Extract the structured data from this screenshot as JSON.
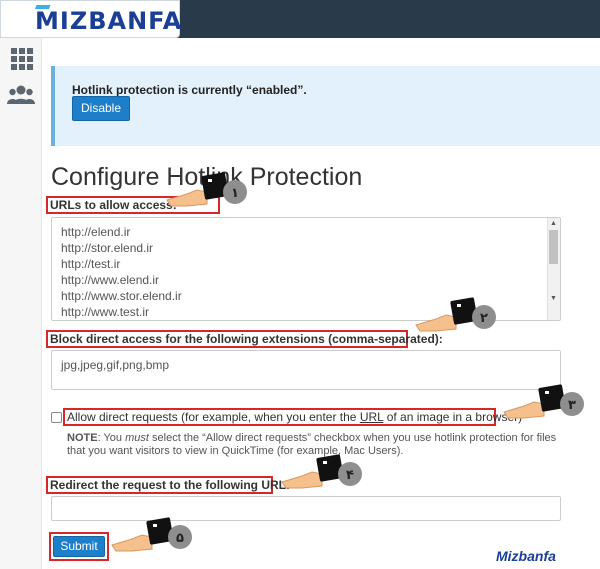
{
  "header": {
    "logo_text": "MIZBANFA"
  },
  "sidebar": {
    "items": [
      {
        "icon": "grid-icon"
      },
      {
        "icon": "users-icon"
      }
    ]
  },
  "alert": {
    "message": "Hotlink protection is currently “enabled”.",
    "button_label": "Disable"
  },
  "page": {
    "title": "Configure Hotlink Protection"
  },
  "urls_section": {
    "label": "URLs to allow access:",
    "urls": [
      "http://elend.ir",
      "http://stor.elend.ir",
      "http://test.ir",
      "http://www.elend.ir",
      "http://www.stor.elend.ir",
      "http://www.test.ir"
    ]
  },
  "extensions_section": {
    "label": "Block direct access for the following extensions (comma-separated):",
    "value": "jpg,jpeg,gif,png,bmp"
  },
  "allow_direct": {
    "label_before": "Allow direct requests (for example, when you enter the ",
    "label_url": "URL",
    "label_after": " of an image in a browser)",
    "checked": false,
    "note_prefix": "NOTE",
    "note_part1": ": You ",
    "note_must": "must",
    "note_part2": " select the “Allow direct requests” checkbox when you use hotlink protection for files that you want visitors to view in QuickTime (for example, Mac Users)."
  },
  "redirect_section": {
    "label": "Redirect the request to the following URL:",
    "value": ""
  },
  "submit": {
    "label": "Submit"
  },
  "step_markers": [
    {
      "number": "۱"
    },
    {
      "number": "۲"
    },
    {
      "number": "۳"
    },
    {
      "number": "۴"
    },
    {
      "number": "۵"
    }
  ],
  "watermark": {
    "text": "Mizbanfa"
  },
  "colors": {
    "topbar": "#293a4a",
    "accent_blue": "#1d7fc9",
    "alert_bg": "#e2f1fb",
    "highlight_red": "#d8262b"
  }
}
